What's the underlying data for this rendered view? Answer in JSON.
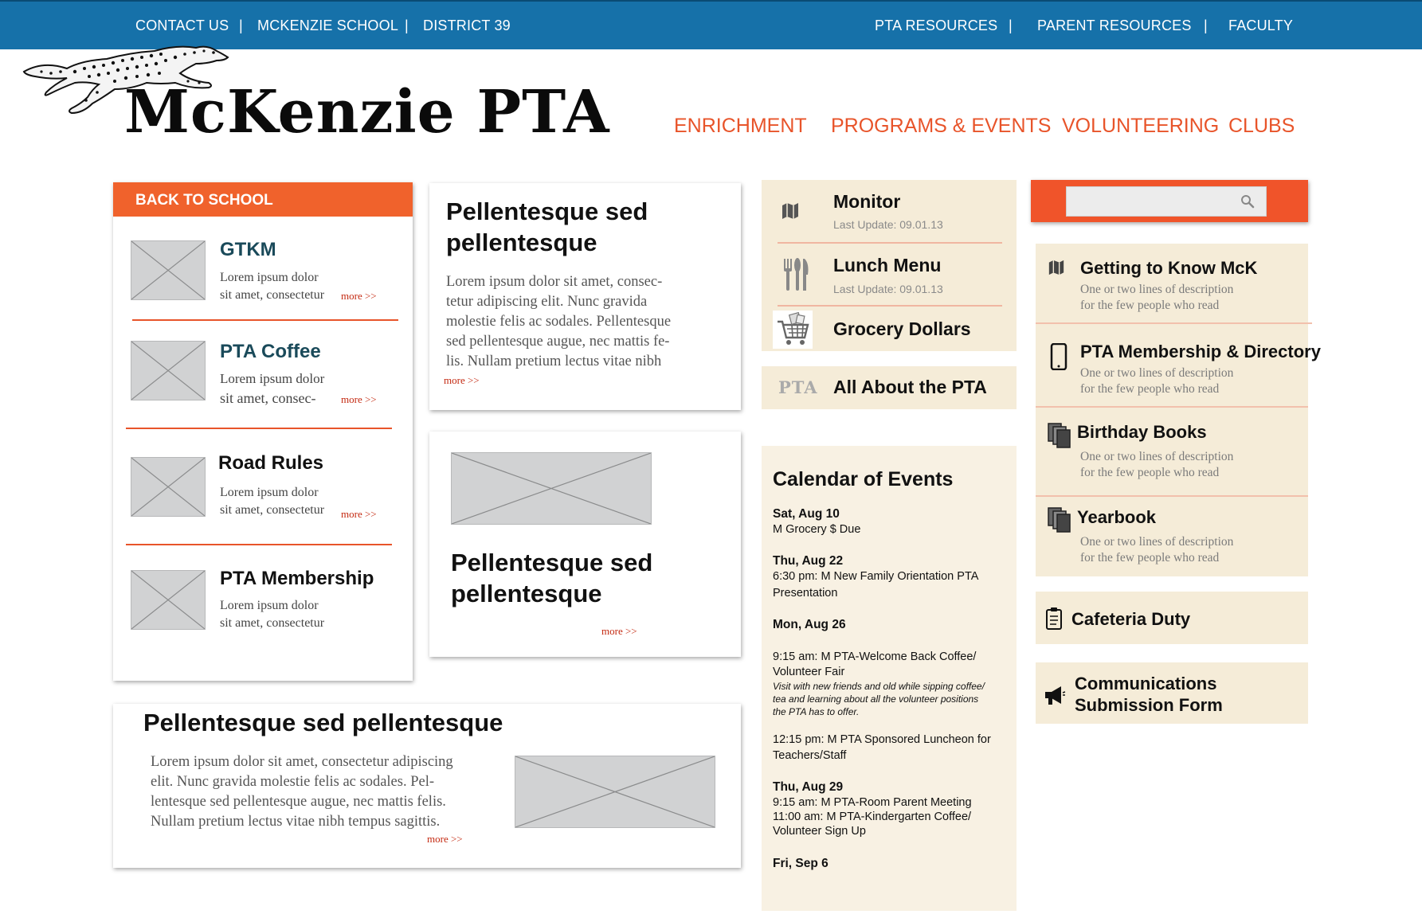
{
  "topbar": {
    "left_links": [
      "CONTACT US",
      "MCKENZIE SCHOOL",
      "DISTRICT 39"
    ],
    "right_links": [
      "PTA RESOURCES",
      "PARENT RESOURCES",
      "FACULTY"
    ],
    "separator": "|"
  },
  "brand": {
    "title": "McKenzie PTA",
    "logo_icon": "cheetah-logo"
  },
  "main_nav": [
    "ENRICHMENT",
    "PROGRAMS & EVENTS",
    "VOLUNTEERING",
    "CLUBS"
  ],
  "back_to_school": {
    "header": "BACK TO SCHOOL",
    "items": [
      {
        "title": "GTKM",
        "desc_line1": "Lorem ipsum dolor",
        "desc_line2": "sit amet, consectetur",
        "more": "more >>",
        "title_color": "#1a4a5a"
      },
      {
        "title": "PTA Coffee",
        "desc_line1": "Lorem ipsum dolor",
        "desc_line2": "sit amet, consec-",
        "more": "more >>",
        "title_color": "#1a4a5a"
      },
      {
        "title": "Road Rules",
        "desc_line1": "Lorem ipsum dolor",
        "desc_line2": "sit amet, consectetur",
        "more": "more >>",
        "title_color": "#111111"
      },
      {
        "title": "PTA Membership",
        "desc_line1": "Lorem ipsum dolor",
        "desc_line2": "sit amet, consectetur",
        "more": "",
        "title_color": "#111111"
      }
    ]
  },
  "article1": {
    "title_line1": "Pellentesque sed",
    "title_line2": "pellentesque",
    "body": [
      "Lorem ipsum dolor sit amet, consec-",
      "tetur adipiscing elit. Nunc gravida",
      "molestie felis ac sodales. Pellentesque",
      "sed pellentesque augue, nec mattis fe-",
      "lis. Nullam pretium lectus vitae nibh"
    ],
    "more": "more >>"
  },
  "article2": {
    "title_line1": "Pellentesque sed",
    "title_line2": "pellentesque",
    "more": "more >>"
  },
  "article3": {
    "title": "Pellentesque sed pellentesque",
    "body": [
      "Lorem ipsum dolor sit amet, consectetur adipiscing",
      "elit. Nunc gravida molestie felis ac sodales. Pel-",
      "lentesque sed pellentesque augue, nec mattis felis.",
      "Nullam pretium lectus vitae nibh tempus sagittis."
    ],
    "more": "more >>"
  },
  "quick_links": {
    "items": [
      {
        "title": "Monitor",
        "sub": "Last Update: 09.01.13",
        "icon": "map-icon"
      },
      {
        "title": "Lunch Menu",
        "sub": "Last Update: 09.01.13",
        "icon": "utensils-icon"
      },
      {
        "title": "Grocery Dollars",
        "sub": "",
        "icon": "shopping-cart-icon"
      }
    ],
    "about": {
      "icon_text": "PTA",
      "title": "All About the PTA"
    }
  },
  "calendar": {
    "title": "Calendar of Events",
    "entries": [
      {
        "date": "Sat, Aug 10",
        "lines": [
          "M Grocery $ Due"
        ]
      },
      {
        "date": "Thu, Aug 22",
        "lines": [
          "6:30 pm: M New Family Orientation PTA",
          "Presentation"
        ]
      },
      {
        "date": "Mon, Aug 26",
        "lines": []
      },
      {
        "date": "",
        "lines": [
          "9:15 am: M PTA-Welcome Back Coffee/",
          "Volunteer Fair"
        ],
        "italic": [
          "Visit with new friends and old while sipping coffee/",
          "tea and learning about all the volunteer positions",
          "the PTA has to offer."
        ]
      },
      {
        "date": "",
        "lines": [
          "12:15 pm: M PTA Sponsored Luncheon for",
          "Teachers/Staff"
        ]
      },
      {
        "date": "Thu, Aug 29",
        "lines": [
          "9:15 am: M PTA-Room Parent Meeting",
          "11:00 am: M PTA-Kindergarten Coffee/",
          "Volunteer Sign Up"
        ]
      },
      {
        "date": "Fri, Sep 6",
        "lines": []
      }
    ]
  },
  "search": {
    "placeholder": "",
    "value": "",
    "icon": "search-icon"
  },
  "resources": {
    "items": [
      {
        "title": "Getting to Know McK",
        "desc_line1": "One or two lines of description",
        "desc_line2": "for the few people who read",
        "icon": "map-icon"
      },
      {
        "title": "PTA Membership & Directory",
        "desc_line1": "One or two lines of description",
        "desc_line2": "for the few people who read",
        "icon": "phone-icon"
      },
      {
        "title": "Birthday Books",
        "desc_line1": "One or two lines of description",
        "desc_line2": "for the few people who read",
        "icon": "books-icon"
      },
      {
        "title": "Yearbook",
        "desc_line1": "One or two lines of description",
        "desc_line2": "for the few people who read",
        "icon": "books-icon"
      }
    ],
    "cafeteria": {
      "title": "Cafeteria Duty",
      "icon": "clipboard-icon"
    },
    "communications": {
      "title_line1": "Communications",
      "title_line2": "Submission Form",
      "icon": "megaphone-icon"
    }
  },
  "colors": {
    "topbar": "#1671a9",
    "accent_orange": "#f0622c",
    "nav_orange": "#e8542a",
    "more_red": "#c42a12",
    "beige": "#f5ecd8",
    "beige_light": "#f8f1e3"
  }
}
